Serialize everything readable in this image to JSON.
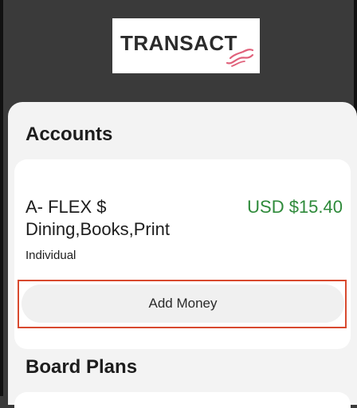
{
  "app": {
    "logo_text": "TRANSACT",
    "colors": {
      "header_bg": "#3a3a3a",
      "sheet_bg": "#f3f3f3",
      "balance_green": "#2e8a3a",
      "highlight_red": "#d84a2f",
      "logo_accent": "#e0607a"
    }
  },
  "accounts": {
    "title": "Accounts",
    "items": [
      {
        "name": "A- FLEX $ Dining,Books,Print",
        "balance": "USD $15.40",
        "type": "Individual",
        "action_label": "Add Money"
      }
    ]
  },
  "board_plans": {
    "title": "Board Plans"
  }
}
